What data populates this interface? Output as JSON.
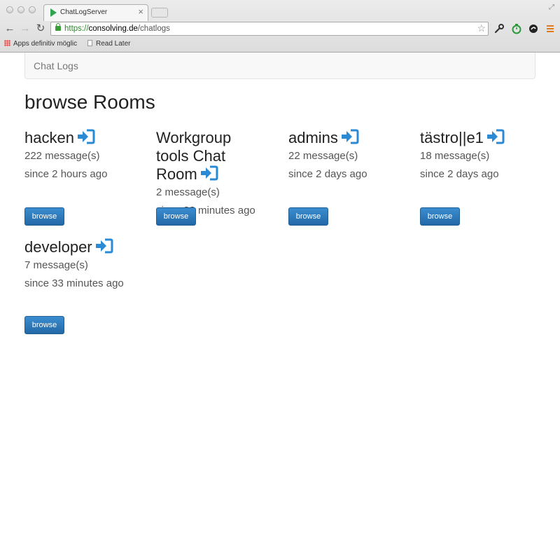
{
  "browser": {
    "tab_title": "ChatLogServer",
    "tab_close": "×",
    "url_scheme": "https://",
    "url_host": "consolving.de",
    "url_path": "/chatlogs",
    "bookmarks": [
      "Apps definitiv möglic",
      "Read Later"
    ]
  },
  "navbar": {
    "brand": "Chat Logs"
  },
  "heading": "browse Rooms",
  "rooms": [
    {
      "name": "hacken",
      "messages": "222 message(s)",
      "since": "since 2 hours ago",
      "button": "browse"
    },
    {
      "name": "Workgroup tools Chat Room",
      "messages": "2 message(s)",
      "since": "since 33 minutes ago",
      "button": "browse"
    },
    {
      "name": "admins",
      "messages": "22 message(s)",
      "since": "since 2 days ago",
      "button": "browse"
    },
    {
      "name": "tästro||e1",
      "messages": "18 message(s)",
      "since": "since 2 days ago",
      "button": "browse"
    },
    {
      "name": "developer",
      "messages": "7 message(s)",
      "since": "since 33 minutes ago",
      "button": "browse"
    }
  ],
  "colors": {
    "accent": "#2a8ad4",
    "button": "#2a6fb0"
  }
}
